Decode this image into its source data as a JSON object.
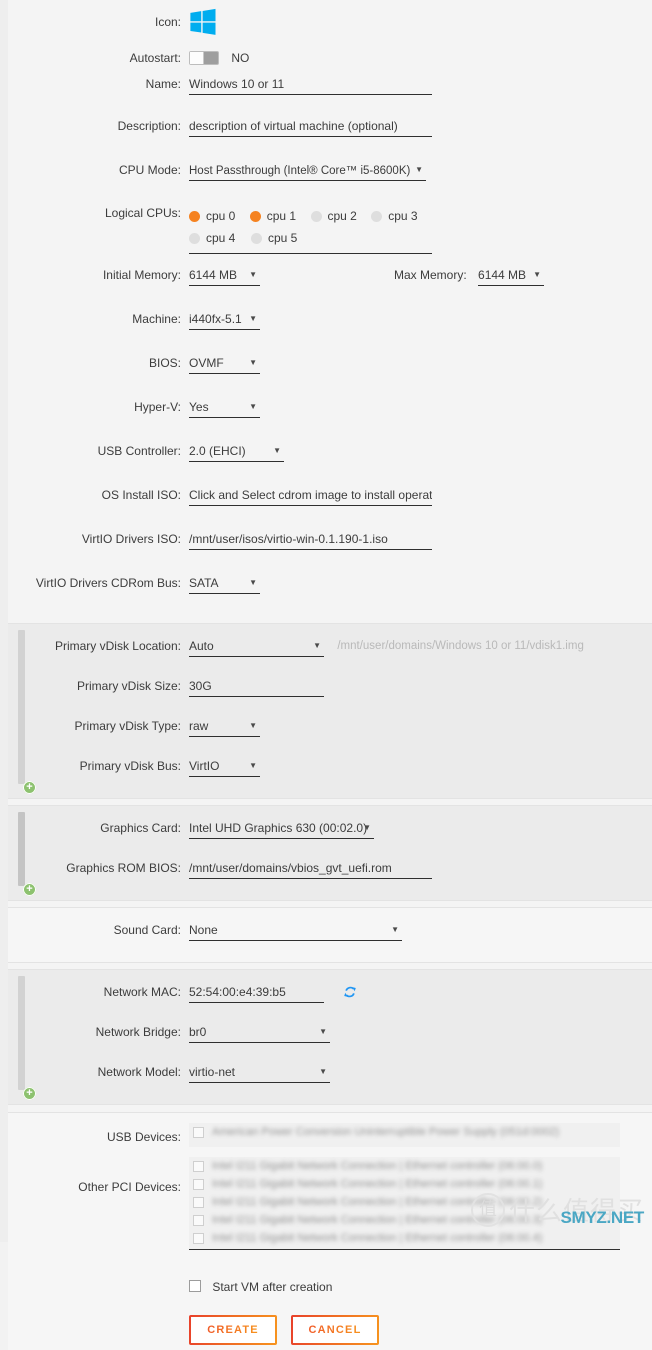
{
  "icon": {
    "label": "Icon:",
    "name": "windows-logo",
    "color": "#00adef"
  },
  "autostart": {
    "label": "Autostart:",
    "state": "NO",
    "on": false
  },
  "name": {
    "label": "Name:",
    "value": "Windows 10 or 11"
  },
  "description": {
    "label": "Description:",
    "placeholder": "description of virtual machine (optional)"
  },
  "cpu_mode": {
    "label": "CPU Mode:",
    "value": "Host Passthrough (Intel® Core™ i5-8600K)"
  },
  "logical_cpus": {
    "label": "Logical CPUs:",
    "items": [
      {
        "name": "cpu 0",
        "selected": true
      },
      {
        "name": "cpu 1",
        "selected": true
      },
      {
        "name": "cpu 2",
        "selected": false
      },
      {
        "name": "cpu 3",
        "selected": false
      },
      {
        "name": "cpu 4",
        "selected": false
      },
      {
        "name": "cpu 5",
        "selected": false
      }
    ]
  },
  "initial_memory": {
    "label": "Initial Memory:",
    "value": "6144 MB"
  },
  "max_memory": {
    "label": "Max Memory:",
    "value": "6144 MB"
  },
  "machine": {
    "label": "Machine:",
    "value": "i440fx-5.1"
  },
  "bios": {
    "label": "BIOS:",
    "value": "OVMF"
  },
  "hyperv": {
    "label": "Hyper-V:",
    "value": "Yes"
  },
  "usb_controller": {
    "label": "USB Controller:",
    "value": "2.0 (EHCI)"
  },
  "os_install_iso": {
    "label": "OS Install ISO:",
    "placeholder": "Click and Select cdrom image to install operating system"
  },
  "virtio_iso": {
    "label": "VirtIO Drivers ISO:",
    "value": "/mnt/user/isos/virtio-win-0.1.190-1.iso"
  },
  "virtio_cdrom_bus": {
    "label": "VirtIO Drivers CDRom Bus:",
    "value": "SATA"
  },
  "vdisk": {
    "location": {
      "label": "Primary vDisk Location:",
      "value": "Auto",
      "hint": "/mnt/user/domains/Windows 10 or 11/vdisk1.img"
    },
    "size": {
      "label": "Primary vDisk Size:",
      "value": "30G"
    },
    "type": {
      "label": "Primary vDisk Type:",
      "value": "raw"
    },
    "bus": {
      "label": "Primary vDisk Bus:",
      "value": "VirtIO"
    },
    "add": "+"
  },
  "graphics": {
    "card": {
      "label": "Graphics Card:",
      "value": "Intel UHD Graphics 630 (00:02.0)"
    },
    "rom_bios": {
      "label": "Graphics ROM BIOS:",
      "value": "/mnt/user/domains/vbios_gvt_uefi.rom"
    },
    "add": "+"
  },
  "sound": {
    "label": "Sound Card:",
    "value": "None"
  },
  "network": {
    "mac": {
      "label": "Network MAC:",
      "value": "52:54:00:e4:39:b5",
      "refresh_icon": "refresh-icon"
    },
    "bridge": {
      "label": "Network Bridge:",
      "value": "br0"
    },
    "model": {
      "label": "Network Model:",
      "value": "virtio-net"
    },
    "add": "+"
  },
  "usb_devices": {
    "label": "USB Devices:",
    "items": [
      {
        "text": "American Power Conversion Uninterruptible Power Supply  (051d:0002)",
        "checked": false
      }
    ]
  },
  "other_pci_devices": {
    "label": "Other PCI Devices:",
    "items": [
      {
        "text": "Intel I211 Gigabit Network Connection | Ethernet controller (06:00.0)",
        "checked": false
      },
      {
        "text": "Intel I211 Gigabit Network Connection | Ethernet controller (06:00.1)",
        "checked": false
      },
      {
        "text": "Intel I211 Gigabit Network Connection | Ethernet controller (06:00.2)",
        "checked": false
      },
      {
        "text": "Intel I211 Gigabit Network Connection | Ethernet controller (06:00.3)",
        "checked": false
      },
      {
        "text": "Intel I211 Gigabit Network Connection | Ethernet controller (06:00.4)",
        "checked": false
      }
    ]
  },
  "start_after_creation": {
    "label": "Start VM after creation",
    "checked": false
  },
  "buttons": {
    "create": "CREATE",
    "cancel": "CANCEL",
    "accent_start": "#e8402b",
    "accent_end": "#f7941e"
  },
  "watermark": {
    "mark": "值",
    "cn": "什么值得买",
    "net": "SMYZ.NET",
    "net_color": "#4aa7c4"
  }
}
